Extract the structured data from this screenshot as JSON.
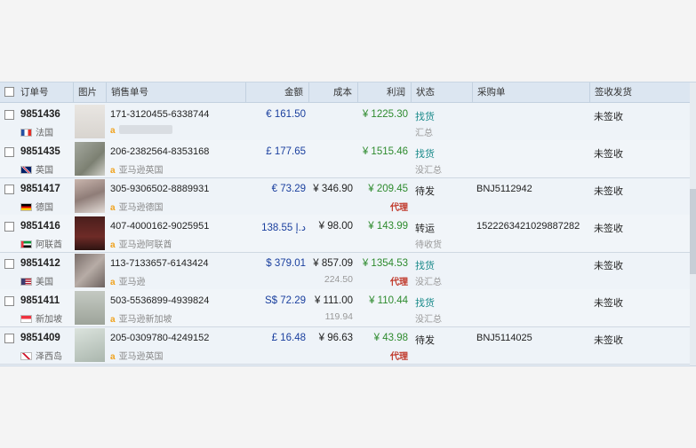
{
  "headers": {
    "order_no": "订单号",
    "image": "图片",
    "sale_no": "销售单号",
    "amount": "金额",
    "cost": "成本",
    "profit": "利润",
    "status": "状态",
    "purchase": "采购单",
    "sign": "签收发货"
  },
  "colors": {
    "amount": "#1a3f9e",
    "profit": "#2e8b2e",
    "agent": "#c0392b",
    "status_link": "#1a8a8a"
  },
  "rows": [
    {
      "order": "9851436",
      "country": "法国",
      "flag": "fr",
      "sale": "171-3120455-6338744",
      "store": "",
      "amount": "€ 161.50",
      "cost": "",
      "cost2": "",
      "profit": "¥ 1225.30",
      "agent": "",
      "status": "找货",
      "status_link": true,
      "status2": "汇总",
      "po": "",
      "sign": "未签收"
    },
    {
      "order": "9851435",
      "country": "英国",
      "flag": "gb",
      "sale": "206-2382564-8353168",
      "store": "亚马逊英国",
      "amount": "£ 177.65",
      "cost": "",
      "cost2": "",
      "profit": "¥ 1515.46",
      "agent": "",
      "status": "找货",
      "status_link": true,
      "status2": "没汇总",
      "po": "",
      "sign": "未签收"
    },
    {
      "order": "9851417",
      "country": "德国",
      "flag": "de",
      "sale": "305-9306502-8889931",
      "store": "亚马逊德国",
      "amount": "€ 73.29",
      "cost": "¥ 346.90",
      "cost2": "",
      "profit": "¥ 209.45",
      "agent": "代理",
      "status": "待发",
      "status_link": false,
      "status2": "",
      "po": "BNJ5112942",
      "sign": "未签收"
    },
    {
      "order": "9851416",
      "country": "阿联酋",
      "flag": "ae",
      "sale": "407-4000162-9025951",
      "store": "亚马逊阿联酋",
      "amount": "د.إ 138.55",
      "cost": "¥ 98.00",
      "cost2": "",
      "profit": "¥ 143.99",
      "agent": "",
      "status": "转运",
      "status_link": false,
      "status2": "待收货",
      "po": "1522263421029887282",
      "sign": "未签收"
    },
    {
      "order": "9851412",
      "country": "美国",
      "flag": "us",
      "sale": "113-7133657-6143424",
      "store": "亚马逊",
      "amount": "$ 379.01",
      "cost": "¥ 857.09",
      "cost2": "224.50",
      "profit": "¥ 1354.53",
      "agent": "代理",
      "status": "找货",
      "status_link": true,
      "status2": "没汇总",
      "po": "",
      "sign": "未签收"
    },
    {
      "order": "9851411",
      "country": "新加坡",
      "flag": "sg",
      "sale": "503-5536899-4939824",
      "store": "亚马逊新加坡",
      "amount": "S$ 72.29",
      "cost": "¥ 111.00",
      "cost2": "119.94",
      "profit": "¥ 110.44",
      "agent": "",
      "status": "找货",
      "status_link": true,
      "status2": "没汇总",
      "po": "",
      "sign": "未签收"
    },
    {
      "order": "9851409",
      "country": "泽西岛",
      "flag": "je",
      "sale": "205-0309780-4249152",
      "store": "亚马逊英国",
      "amount": "£ 16.48",
      "cost": "¥ 96.63",
      "cost2": "",
      "profit": "¥ 43.98",
      "agent": "代理",
      "status": "待发",
      "status_link": false,
      "status2": "",
      "po": "BNJ5114025",
      "sign": "未签收"
    }
  ]
}
